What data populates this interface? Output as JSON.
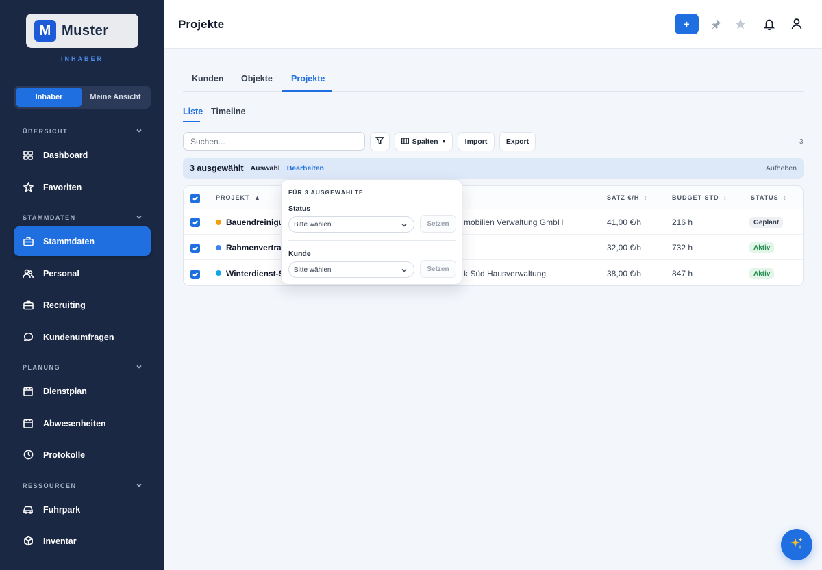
{
  "brand": {
    "name": "Muster",
    "mark": "M",
    "role_label": "INHABER"
  },
  "role_toggle": {
    "options": [
      "Inhaber",
      "Meine Ansicht"
    ],
    "active": 0
  },
  "sidebar": {
    "sections": [
      {
        "label": "ÜBERSICHT"
      },
      {
        "label": "STAMMDATEN"
      },
      {
        "label": "PLANUNG"
      },
      {
        "label": "RESSOURCEN"
      }
    ],
    "items": [
      {
        "label": "Dashboard",
        "icon": "grid-icon"
      },
      {
        "label": "Favoriten",
        "icon": "star-icon"
      },
      {
        "label": "Stammdaten",
        "icon": "briefcase-icon",
        "active": true
      },
      {
        "label": "Personal",
        "icon": "people-icon"
      },
      {
        "label": "Recruiting",
        "icon": "briefcase-icon"
      },
      {
        "label": "Kundenumfragen",
        "icon": "chat-icon"
      },
      {
        "label": "Dienstplan",
        "icon": "calendar-icon"
      },
      {
        "label": "Abwesenheiten",
        "icon": "calendar-icon"
      },
      {
        "label": "Protokolle",
        "icon": "clock-icon"
      },
      {
        "label": "Fuhrpark",
        "icon": "car-icon"
      },
      {
        "label": "Inventar",
        "icon": "box-icon"
      }
    ]
  },
  "header": {
    "title": "Projekte",
    "add_label": "+"
  },
  "tabs": [
    {
      "label": "Kunden"
    },
    {
      "label": "Objekte"
    },
    {
      "label": "Projekte",
      "active": true
    }
  ],
  "subtabs": [
    {
      "label": "Liste",
      "active": true
    },
    {
      "label": "Timeline"
    }
  ],
  "toolbar": {
    "search_placeholder": "Suchen...",
    "columns_label": "Spalten",
    "import_label": "Import",
    "export_label": "Export",
    "count": "3"
  },
  "selection_bar": {
    "count_text": "3 ausgewählt",
    "select_label": "Auswahl",
    "edit_label": "Bearbeiten",
    "cancel_label": "Aufheben"
  },
  "table": {
    "headers": {
      "project": "PROJEKT",
      "rate": "SATZ €/H",
      "budget": "BUDGET STD",
      "status": "STATUS"
    },
    "sort_asc": "▲",
    "sort_both": "↕",
    "rows": [
      {
        "name": "Bauendreinigung",
        "customer": "mobilien Verwaltung GmbH",
        "rate": "41,00 €/h",
        "budget": "216 h",
        "status": "Geplant",
        "dot": "#f59e0b",
        "status_bg": "#eef0f3",
        "status_fg": "#374151"
      },
      {
        "name": "Rahmenvertrag",
        "customer": "",
        "rate": "32,00 €/h",
        "budget": "732 h",
        "status": "Aktiv",
        "dot": "#3b82f6",
        "status_bg": "#e3f5e9",
        "status_fg": "#1f8a4c"
      },
      {
        "name": "Winterdienst-Saison",
        "customer": "k Süd Hausverwaltung",
        "rate": "38,00 €/h",
        "budget": "847 h",
        "status": "Aktiv",
        "dot": "#0ea5e9",
        "status_bg": "#e3f5e9",
        "status_fg": "#1f8a4c"
      }
    ]
  },
  "bulk_edit": {
    "heading": "FÜR 3 AUSGEWÄHLTE",
    "status_label": "Status",
    "status_value": "Bitte wählen",
    "customer_label": "Kunde",
    "customer_value": "Bitte wählen",
    "apply_label": "Setzen"
  },
  "colors": {
    "accent": "#1f6fe0",
    "sidebar": "#1a2843"
  }
}
